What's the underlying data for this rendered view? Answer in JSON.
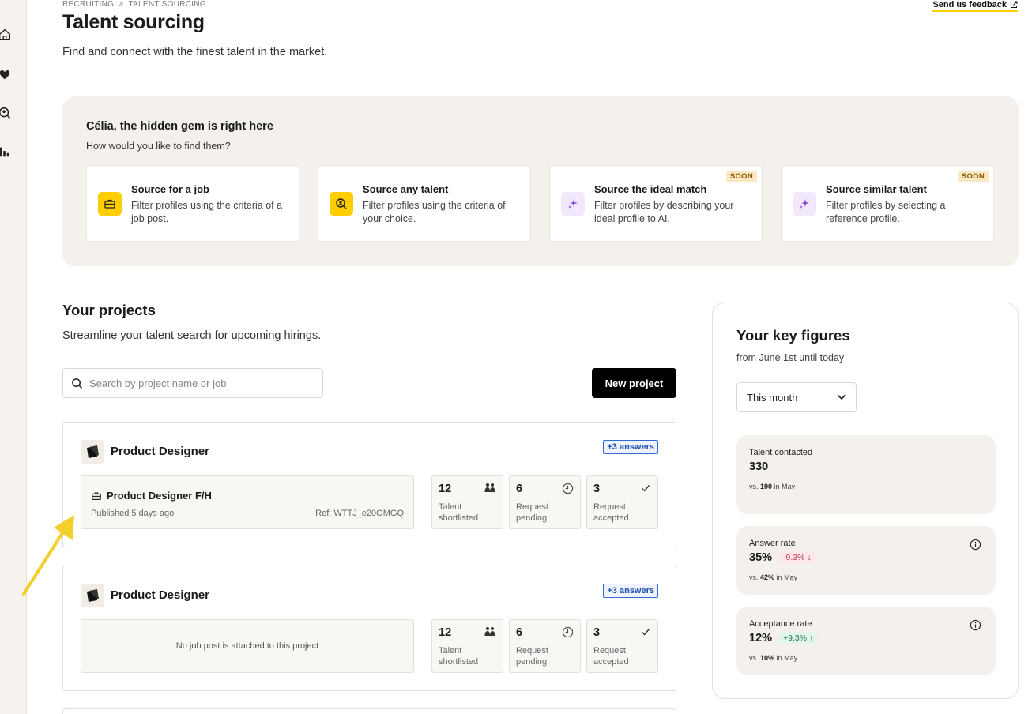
{
  "breadcrumb": {
    "parent": "RECRUITING",
    "separator": ">",
    "current": "TALENT SOURCING"
  },
  "header": {
    "title": "Talent sourcing",
    "subtitle": "Find and connect with the finest talent in the market.",
    "feedback_label": "Send us feedback"
  },
  "rail": {
    "icons": [
      "home-icon",
      "heart-icon",
      "search-person-icon",
      "chart-icon"
    ]
  },
  "hero": {
    "title": "Célia, the hidden gem is right here",
    "subtitle": "How would you like to find them?",
    "cards": [
      {
        "title": "Source for a job",
        "desc": "Filter profiles using the criteria of a job post.",
        "badge": "",
        "icon": "briefcase-icon"
      },
      {
        "title": "Source any talent",
        "desc": "Filter profiles using the criteria of your choice.",
        "badge": "",
        "icon": "person-search-icon"
      },
      {
        "title": "Source the ideal match",
        "desc": "Filter profiles by describing your ideal profile to AI.",
        "badge": "SOON",
        "icon": "sparkle-icon"
      },
      {
        "title": "Source similar talent",
        "desc": "Filter profiles by selecting a reference profile.",
        "badge": "SOON",
        "icon": "sparkle-icon"
      }
    ]
  },
  "projects": {
    "title": "Your projects",
    "subtitle": "Streamline your talent search for upcoming hirings.",
    "search_placeholder": "Search by project name or job",
    "new_project_label": "New project",
    "items": [
      {
        "name": "Product Designer",
        "answers": "+3 answers",
        "job_title": "Product Designer F/H",
        "job_published": "Published 5 days ago",
        "job_ref": "Ref: WTTJ_e20OMGQ",
        "empty_job": "",
        "stats": [
          {
            "value": "12",
            "line1": "Talent",
            "line2": "shortlisted"
          },
          {
            "value": "6",
            "line1": "Request",
            "line2": "pending"
          },
          {
            "value": "3",
            "line1": "Request",
            "line2": "accepted"
          }
        ]
      },
      {
        "name": "Product Designer",
        "answers": "+3 answers",
        "job_title": "",
        "job_published": "",
        "job_ref": "",
        "empty_job": "No job post is attached to this project",
        "stats": [
          {
            "value": "12",
            "line1": "Talent",
            "line2": "shortlisted"
          },
          {
            "value": "6",
            "line1": "Request",
            "line2": "pending"
          },
          {
            "value": "3",
            "line1": "Request",
            "line2": "accepted"
          }
        ]
      }
    ]
  },
  "key_figures": {
    "title": "Your key figures",
    "subtitle": "from June 1st until today",
    "period": "This month",
    "metrics": [
      {
        "label": "Talent contacted",
        "value": "330",
        "delta": "",
        "cmp_prefix": "vs.",
        "cmp_value": "190",
        "cmp_suffix": "in May"
      },
      {
        "label": "Answer rate",
        "value": "35%",
        "delta": "-9.3% ↓",
        "cmp_prefix": "vs.",
        "cmp_value": "42%",
        "cmp_suffix": "in May"
      },
      {
        "label": "Acceptance rate",
        "value": "12%",
        "delta": "+9.3% ↑",
        "cmp_prefix": "vs.",
        "cmp_value": "10%",
        "cmp_suffix": "in May"
      }
    ]
  },
  "colors": {
    "accent": "#ffcd00",
    "hero_bg": "#f4f1ec",
    "link_blue": "#2f6ad8",
    "negative": "#c4314b",
    "positive": "#1b7a4b"
  }
}
